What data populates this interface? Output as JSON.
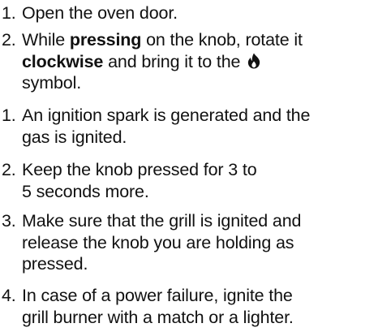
{
  "steps_a": [
    {
      "num": "1.",
      "text": "Open the oven door."
    },
    {
      "num": "2.",
      "text_pre": "While ",
      "bold1": "pressing",
      "text_mid": " on the knob, rotate it",
      "bold2": "clockwise",
      "text_post": " and bring it to the ",
      "icon": "flame-icon",
      "line3": "symbol."
    }
  ],
  "steps_b": [
    {
      "num": "1.",
      "line1": "An ignition spark is generated and the",
      "line2": "gas is ignited."
    },
    {
      "num": "2.",
      "line1": "Keep the knob pressed for 3 to",
      "line2": "5  seconds more."
    },
    {
      "num": "3.",
      "line1": "Make sure that the grill is ignited and",
      "line2": "release the knob you are holding as",
      "line3": "pressed."
    },
    {
      "num": "4.",
      "line1": "In case of a power failure, ignite the",
      "line2": "grill burner with a match or a lighter."
    }
  ]
}
